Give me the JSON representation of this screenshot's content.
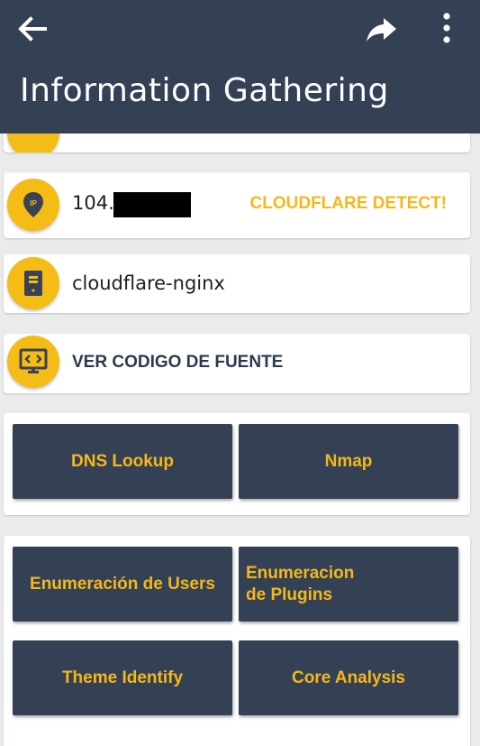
{
  "app_bar": {
    "title": "Information Gathering",
    "background": "#344155",
    "icons": {
      "back": "arrow-back-icon",
      "share": "share-icon",
      "more": "more-vertical-icon"
    }
  },
  "ip_row": {
    "ip_prefix": "104.",
    "ip_redacted": true,
    "status": "CLOUDFLARE DETECT!",
    "icon": "ip-location-pin-icon"
  },
  "server_row": {
    "server": "cloudflare-nginx",
    "icon": "server-icon"
  },
  "source_row": {
    "label": "VER CODIGO DE FUENTE",
    "icon": "code-monitor-icon"
  },
  "tools_group_1": {
    "buttons": [
      {
        "label": "DNS Lookup"
      },
      {
        "label": "Nmap"
      }
    ]
  },
  "tools_group_2": {
    "buttons": [
      {
        "label": "Enumeración de Users"
      },
      {
        "label": "Enumeracion de Plugins"
      },
      {
        "label": "Theme Identify"
      },
      {
        "label": "Core Analysis"
      }
    ]
  },
  "colors": {
    "accent": "#f5bc16",
    "tile_background": "#344155",
    "page_background": "#eaeceb"
  }
}
